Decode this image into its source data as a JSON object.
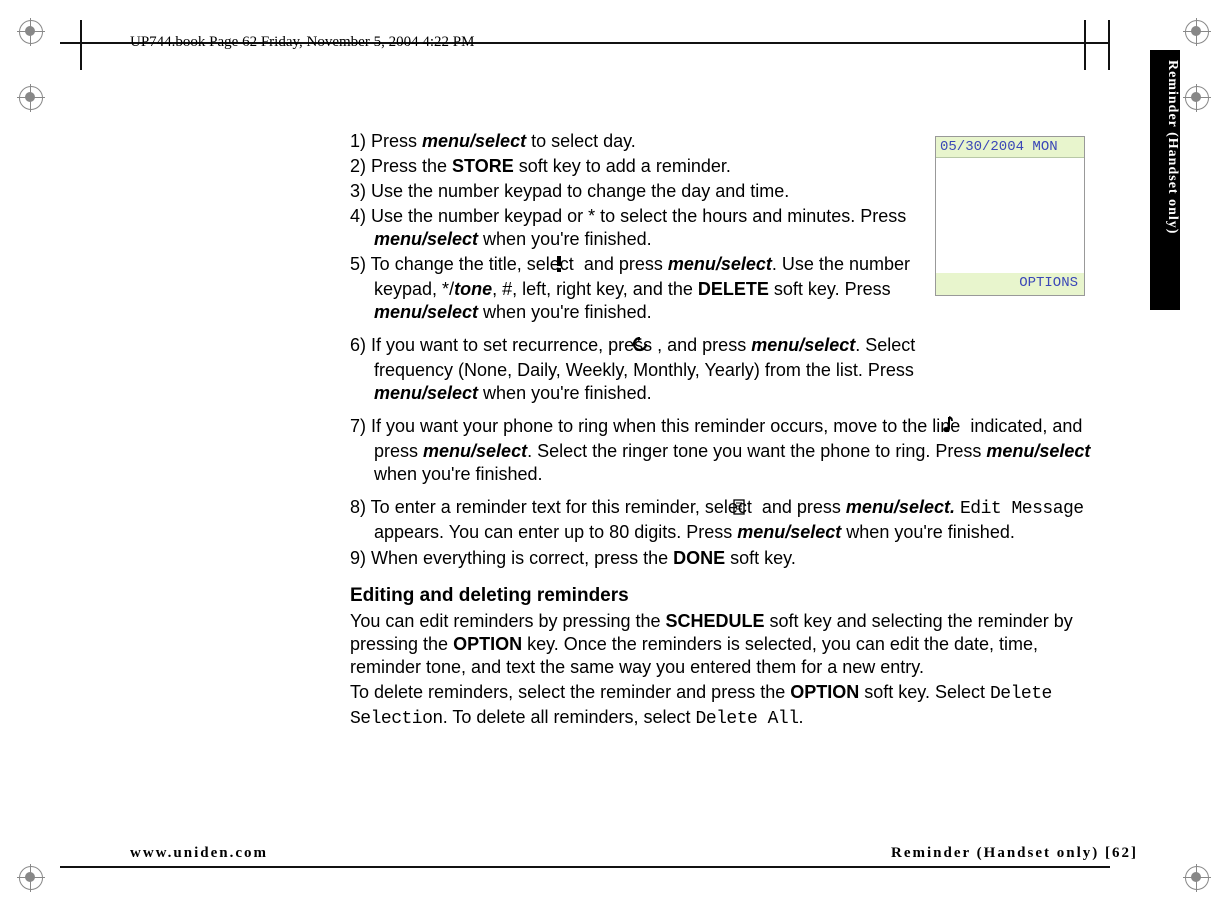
{
  "meta_header": "UP744.book  Page 62  Friday, November 5, 2004  4:22 PM",
  "side_tab": "Reminder (Handset only)",
  "screen": {
    "date": "05/30/2004 MON",
    "softkey_right": "OPTIONS"
  },
  "steps": {
    "s1_a": "1) Press ",
    "s1_b": "menu/select",
    "s1_c": " to select day.",
    "s2_a": "2) Press the ",
    "s2_b": "STORE",
    "s2_c": " soft key to add a reminder.",
    "s3": "3) Use the number keypad to change the day and time.",
    "s4_a": "4) Use the number keypad or ",
    "s4_star": "*",
    "s4_b": " to select the hours and minutes. Press ",
    "s4_c": "menu/select",
    "s4_d": " when you're finished.",
    "s5_a": "5) To change the title, select ",
    "s5_b": " and press ",
    "s5_c": "menu/select",
    "s5_d": ". Use the number keypad, ",
    "s5_star": "*",
    "s5_e": "/",
    "s5_tone": "tone",
    "s5_f": ", #, left, right key, and the ",
    "s5_g": "DELETE",
    "s5_h": " soft key. Press ",
    "s5_i": "menu/select",
    "s5_j": " when you're finished.",
    "s6_a": "6) If you want to set recurrence, press ",
    "s6_b": ", and press ",
    "s6_c": "menu/",
    "s6_c2": "select",
    "s6_d": ". Select frequency (None, Daily, Weekly, Monthly, Yearly) from the list. Press ",
    "s6_e": "menu/select",
    "s6_f": " when you're finished.",
    "s7_a": "7) If you want your phone to ring when this reminder occurs, move to the line ",
    "s7_b": " indicated, and press ",
    "s7_c": "menu/select",
    "s7_d": ". Select the ringer tone you want the phone to ring. Press ",
    "s7_e": "menu/select",
    "s7_f": " when you're finished.",
    "s8_a": "8) To enter a reminder text for this reminder, select ",
    "s8_b": " and press ",
    "s8_c": "menu/select.",
    "s8_d": " ",
    "s8_edit": "Edit Message",
    "s8_e": " appears. You can enter up to 80 digits. Press ",
    "s8_f": "menu/select",
    "s8_g": " when you're finished.",
    "s9_a": "9) When everything is correct, press the ",
    "s9_b": "DONE",
    "s9_c": " soft key."
  },
  "section2": {
    "title": "Editing and deleting reminders",
    "p1_a": "You can edit reminders by pressing the ",
    "p1_b": "SCHEDULE",
    "p1_c": " soft key and selecting the reminder by pressing the ",
    "p1_d": "OPTION",
    "p1_e": " key. Once the reminders is selected, you can edit the date, time, reminder tone, and text the same way you entered them for a new entry.",
    "p2_a": "To delete reminders, select the reminder and press the ",
    "p2_b": "OPTION",
    "p2_c": " soft key. Select ",
    "p2_d": "Delete Selection",
    "p2_e": ". To delete all reminders, select ",
    "p2_f": "Delete All",
    "p2_g": "."
  },
  "footer": {
    "left": "www.uniden.com",
    "right": "Reminder (Handset only) [62]"
  }
}
